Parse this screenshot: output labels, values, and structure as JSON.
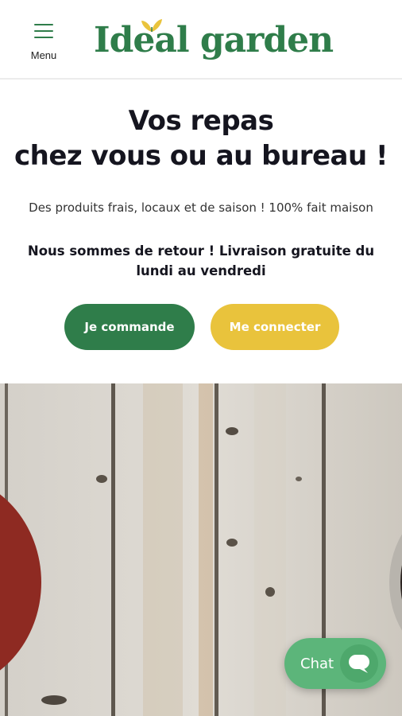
{
  "header": {
    "menu_label": "Menu",
    "logo_text": "Ideal garden",
    "brand_color": "#2f7d4a"
  },
  "hero": {
    "title_line1": "Vos repas",
    "title_line2": "chez vous ou au bureau !",
    "subtitle": "Des produits frais, locaux et de saison ! 100% fait maison",
    "notice": "Nous sommes de retour ! Livraison gratuite du lundi au vendredi",
    "order_button": "Je commande",
    "login_button": "Me connecter",
    "accent_color": "#e9c33c"
  },
  "chat": {
    "label": "Chat",
    "color": "#5cb57a"
  }
}
